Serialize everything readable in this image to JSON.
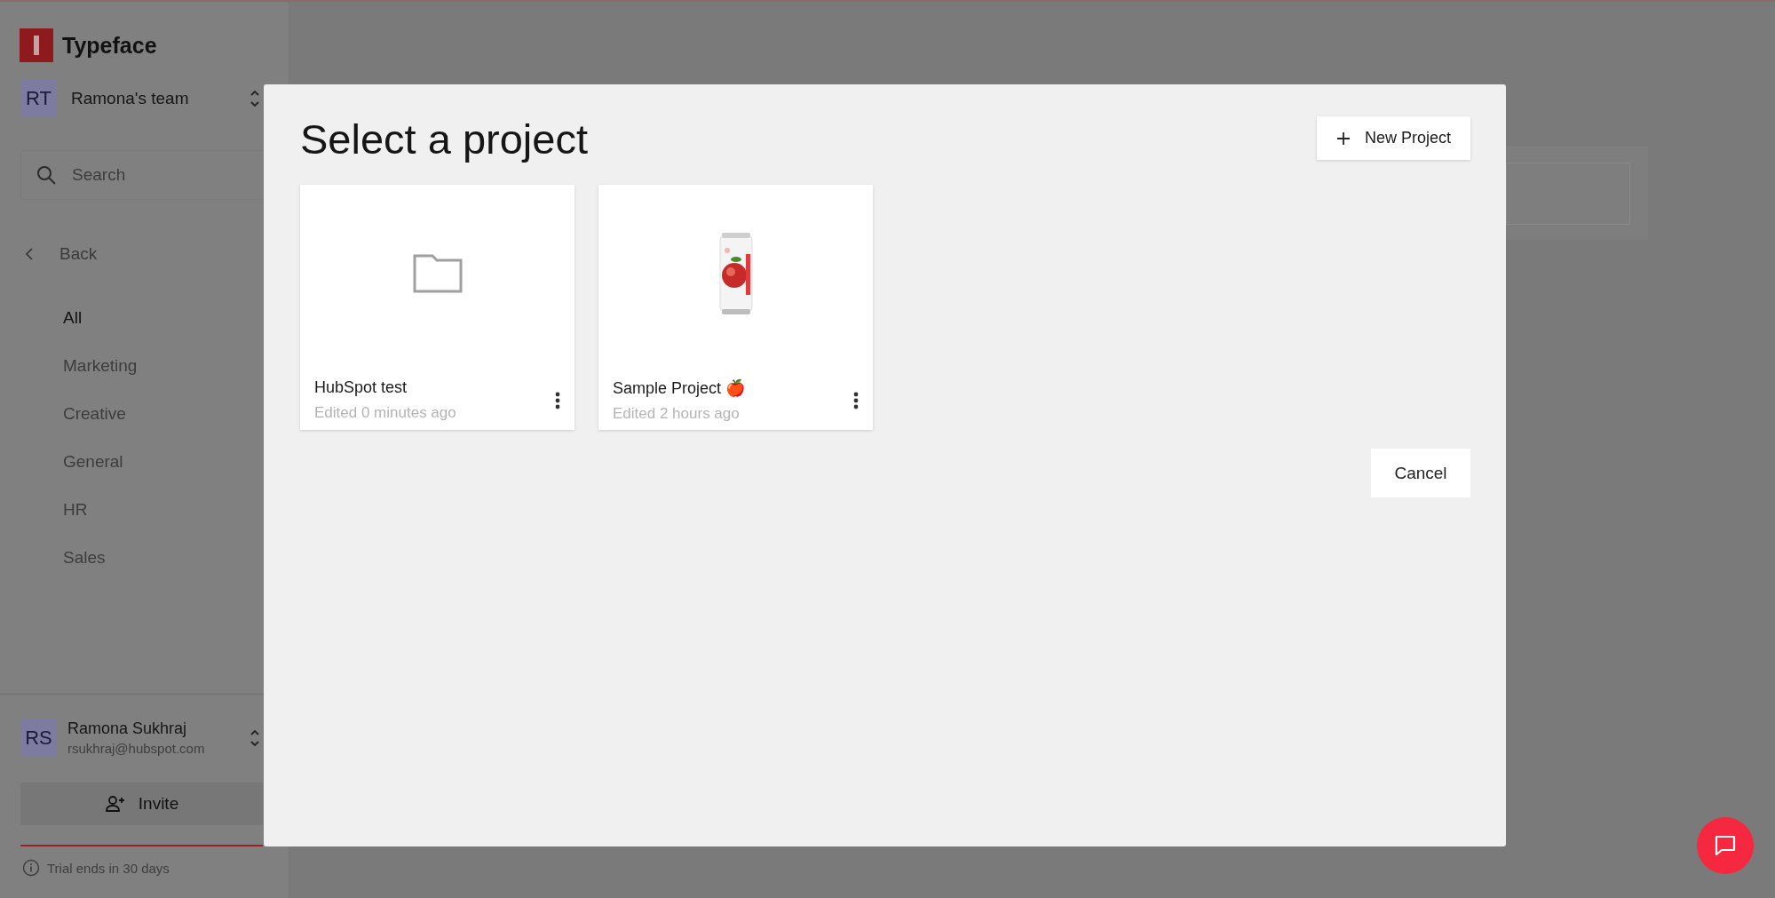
{
  "sidebar": {
    "brand": "Typeface",
    "team": {
      "initials": "RT",
      "name": "Ramona's team"
    },
    "search": {
      "placeholder": "Search"
    },
    "back": "Back",
    "items": [
      {
        "label": "All",
        "selected": true
      },
      {
        "label": "Marketing",
        "selected": false
      },
      {
        "label": "Creative",
        "selected": false
      },
      {
        "label": "General",
        "selected": false
      },
      {
        "label": "HR",
        "selected": false
      },
      {
        "label": "Sales",
        "selected": false
      }
    ],
    "user": {
      "initials": "RS",
      "name": "Ramona Sukhraj",
      "email": "rsukhraj@hubspot.com"
    },
    "invite": "Invite",
    "trial": "Trial ends in 30 days"
  },
  "modal": {
    "title": "Select a project",
    "new_button": "New Project",
    "cancel": "Cancel",
    "projects": [
      {
        "kind": "folder",
        "name": "HubSpot test",
        "edited": "Edited 0 minutes ago"
      },
      {
        "kind": "picture",
        "name": "Sample Project 🍎",
        "edited": "Edited 2 hours ago"
      }
    ]
  }
}
